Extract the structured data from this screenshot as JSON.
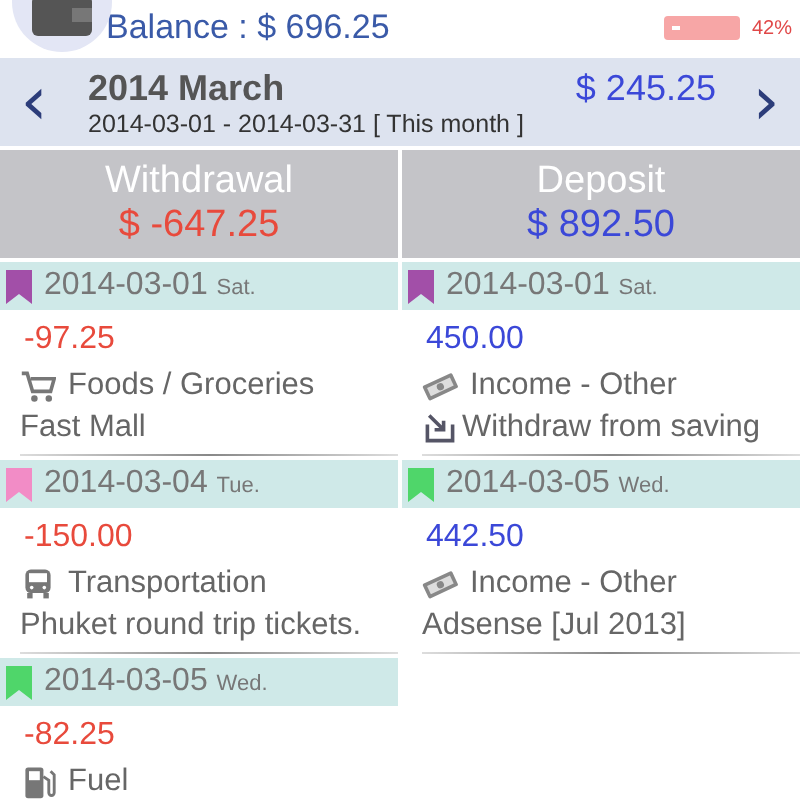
{
  "header": {
    "balance": "Balance : $ 696.25",
    "budget_reading": "42%"
  },
  "period": {
    "title": "2014 March",
    "amount": "$ 245.25",
    "range": "2014-03-01 - 2014-03-31 [ This month ]",
    "prev": "‹",
    "next": "›"
  },
  "columns": [
    {
      "kind": "withdrawal",
      "title": "Withdrawal",
      "total": "$ -647.25",
      "days": [
        {
          "date": "2014-03-01",
          "weekday": "Sat.",
          "color": "#a24fa8",
          "entries": [
            {
              "amount": "-97.25",
              "kind": "cart",
              "category": "Foods / Groceries",
              "note": {
                "kind": "plain",
                "text": "Fast Mall"
              }
            }
          ]
        },
        {
          "date": "2014-03-04",
          "weekday": "Tue.",
          "color": "#f28cc6",
          "entries": [
            {
              "amount": "-150.00",
              "kind": "bus",
              "category": "Transportation",
              "note": {
                "kind": "plain",
                "text": "Phuket round trip tickets."
              }
            }
          ]
        },
        {
          "date": "2014-03-05",
          "weekday": "Wed.",
          "color": "#4fd66a",
          "entries": [
            {
              "amount": "-82.25",
              "kind": "fuel",
              "category": "Fuel"
            }
          ]
        }
      ]
    },
    {
      "kind": "deposit",
      "title": "Deposit",
      "total": "$ 892.50",
      "days": [
        {
          "date": "2014-03-01",
          "weekday": "Sat.",
          "color": "#a24fa8",
          "entries": [
            {
              "amount": "450.00",
              "kind": "money",
              "category": "Income - Other",
              "note": {
                "kind": "transfer",
                "text": "Withdraw from saving"
              }
            }
          ]
        },
        {
          "date": "2014-03-05",
          "weekday": "Wed.",
          "color": "#4fd66a",
          "entries": [
            {
              "amount": "442.50",
              "kind": "money",
              "category": "Income - Other",
              "note": {
                "kind": "plain",
                "text": "Adsense [Jul 2013]"
              }
            }
          ]
        }
      ]
    }
  ]
}
